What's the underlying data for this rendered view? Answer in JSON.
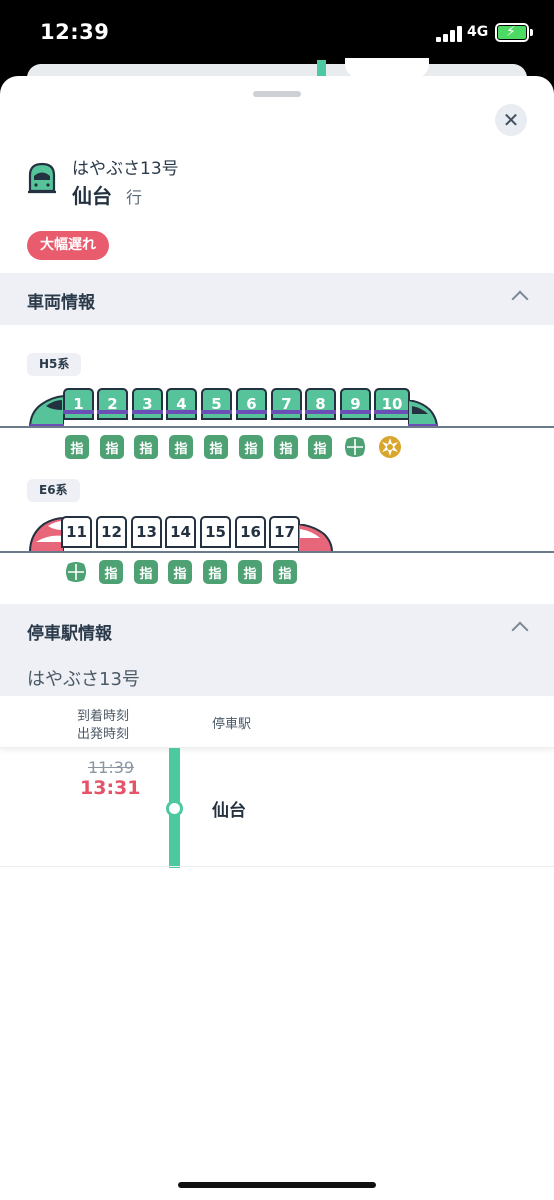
{
  "status_bar": {
    "time": "12:39",
    "network": "4G",
    "battery_state": "charging",
    "battery_color": "#4cd964"
  },
  "header": {
    "train_name": "はやぶさ13号",
    "destination": "仙台",
    "destination_suffix": "行",
    "delay_badge": "大幅遅れ",
    "delay_color": "#e85c6d",
    "train_icon": "shinkansen-icon",
    "close_icon": "close-icon"
  },
  "car_info": {
    "title": "車両情報",
    "sets": [
      {
        "series": "H5系",
        "cars": [
          "1",
          "2",
          "3",
          "4",
          "5",
          "6",
          "7",
          "8",
          "9",
          "10"
        ],
        "seats": [
          "指",
          "指",
          "指",
          "指",
          "指",
          "指",
          "指",
          "指",
          "green",
          "gran"
        ]
      },
      {
        "series": "E6系",
        "cars": [
          "11",
          "12",
          "13",
          "14",
          "15",
          "16",
          "17"
        ],
        "seats": [
          "green",
          "指",
          "指",
          "指",
          "指",
          "指",
          "指"
        ]
      }
    ]
  },
  "stop_info": {
    "title": "停車駅情報",
    "train_name": "はやぶさ13号",
    "col_time_line1": "到着時刻",
    "col_time_line2": "出発時刻",
    "col_station": "停車駅",
    "stops": [
      {
        "scheduled": "11:39",
        "actual": "13:31",
        "station": "仙台"
      }
    ]
  },
  "colors": {
    "accent_green": "#4cc9a0",
    "h5_body": "#57c39a",
    "h5_stripe": "#6b4fb7",
    "e6_accent": "#e8667a",
    "delay_text": "#e45367",
    "seat_reserved": "#4da173"
  }
}
